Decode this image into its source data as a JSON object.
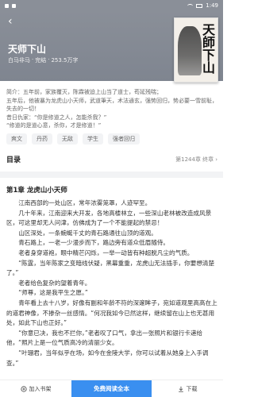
{
  "status": {
    "time": "1:49"
  },
  "book": {
    "title": "天师下山",
    "meta": [
      "白马非马",
      "·",
      "完结",
      "·",
      "253.5万字"
    ],
    "cover_text": "天師下山"
  },
  "intro": {
    "lines": [
      "简介：五年前，家族覆灭，陈霖被迫上山当了道士，苟延残喘；",
      "五年后，他被暴为龙虎山小天师，武道筆天，术法通玄，强势回归，势必要一雪前耻，",
      "失去的一切！",
      "昔日仇家：“你是修道之人，怎能杀我？”",
      "“修道的是道心意，杀你，才是修道！”"
    ]
  },
  "tags": [
    "爽文",
    "丹药",
    "无敌",
    "学生",
    "强者回归"
  ],
  "catalog": {
    "label": "目录",
    "status": "第1244章 终章",
    "chevron": "›"
  },
  "chapter": {
    "title": "第1章 龙虎山小天师",
    "paragraphs": [
      "江南西部的一处山区，常年浓雾笼罩，人迹罕至。",
      "几十年来，江南迎来大开发，各地高楼林立，一些深山老林被改造成风景区，可这里却无人问津，仿佛成为了一个不能提起的禁忌！",
      "山区深处，一条蜿蜒千丈的青石路通往山顶的道观。",
      "青石路上，一老一少漫步而下，路边旁有道众低眉随侍。",
      "老者身穿道袍，眼中精芒闪烁，一举一动皆有种超脱凡尘的气质。",
      "“陈霆，当年陈家之变暗线伏疑，黑幕重重，龙虎山无法插手，你要想清楚了。”",
      "老者给色复杂的望着青年。",
      "“师尊，这是我平生之愿。”",
      "青年看上去十八岁，好像有副和年龄不符的深邃眸子，宛如道观里高高在上的道君神像，不掺杂一丝感情。“何况我如今已然这样，继续留在山上也无甚用处，如此下山也正好。”",
      "“你意已决，我也不拦你，”老者叹了口气，拿出一张照片和银行卡递给他，“照片上是一位气质高冷的清丽少女。",
      "“叶珊君，当年似乎在场，如今在金陵大学，你可以试着从她身上入手调查。”"
    ]
  },
  "bottom": {
    "add_shelf": "加入书架",
    "read": "免费阅读全本",
    "download": "下载"
  }
}
